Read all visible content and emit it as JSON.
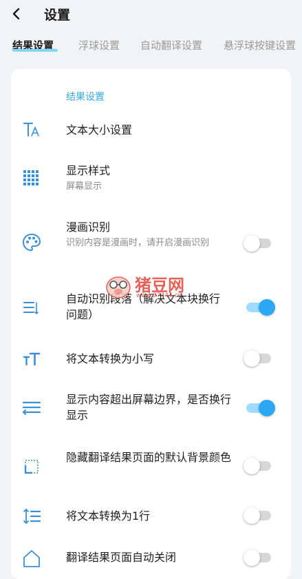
{
  "header": {
    "title": "设置"
  },
  "tabs": [
    {
      "label": "结果设置",
      "active": true
    },
    {
      "label": "浮球设置",
      "active": false
    },
    {
      "label": "自动翻译设置",
      "active": false
    },
    {
      "label": "悬浮球按键设置",
      "active": false
    }
  ],
  "section_title": "结果设置",
  "rows": [
    {
      "title": "文本大小设置",
      "subtitle": "",
      "icon": "text-size-icon",
      "toggle": null
    },
    {
      "title": "显示样式",
      "subtitle": "屏幕显示",
      "icon": "grid-dots-icon",
      "toggle": null
    },
    {
      "title": "漫画识别",
      "subtitle": "识别内容是漫画时，请开启漫画识别",
      "icon": "palette-icon",
      "toggle": false
    },
    {
      "title": "自动识别段落（解决文本块换行问题）",
      "subtitle": "",
      "icon": "paragraph-icon",
      "toggle": true
    },
    {
      "title": "将文本转换为小写",
      "subtitle": "",
      "icon": "lowercase-icon",
      "toggle": false
    },
    {
      "title": "显示内容超出屏幕边界，是否换行显示",
      "subtitle": "",
      "icon": "wrap-icon",
      "toggle": true
    },
    {
      "title": "隐藏翻译结果页面的默认背景颜色",
      "subtitle": "",
      "icon": "background-icon",
      "toggle": false
    },
    {
      "title": "将文本转换为1行",
      "subtitle": "",
      "icon": "line-height-icon",
      "toggle": false
    },
    {
      "title": "翻译结果页面自动关闭",
      "subtitle": "",
      "icon": "home-icon",
      "toggle": false
    }
  ],
  "watermark": {
    "name": "猪豆网",
    "url": "www.97444.cn"
  },
  "colors": {
    "accent": "#2aa8f2",
    "icon": "#3b8fd6",
    "section": "#3aa8dc"
  }
}
